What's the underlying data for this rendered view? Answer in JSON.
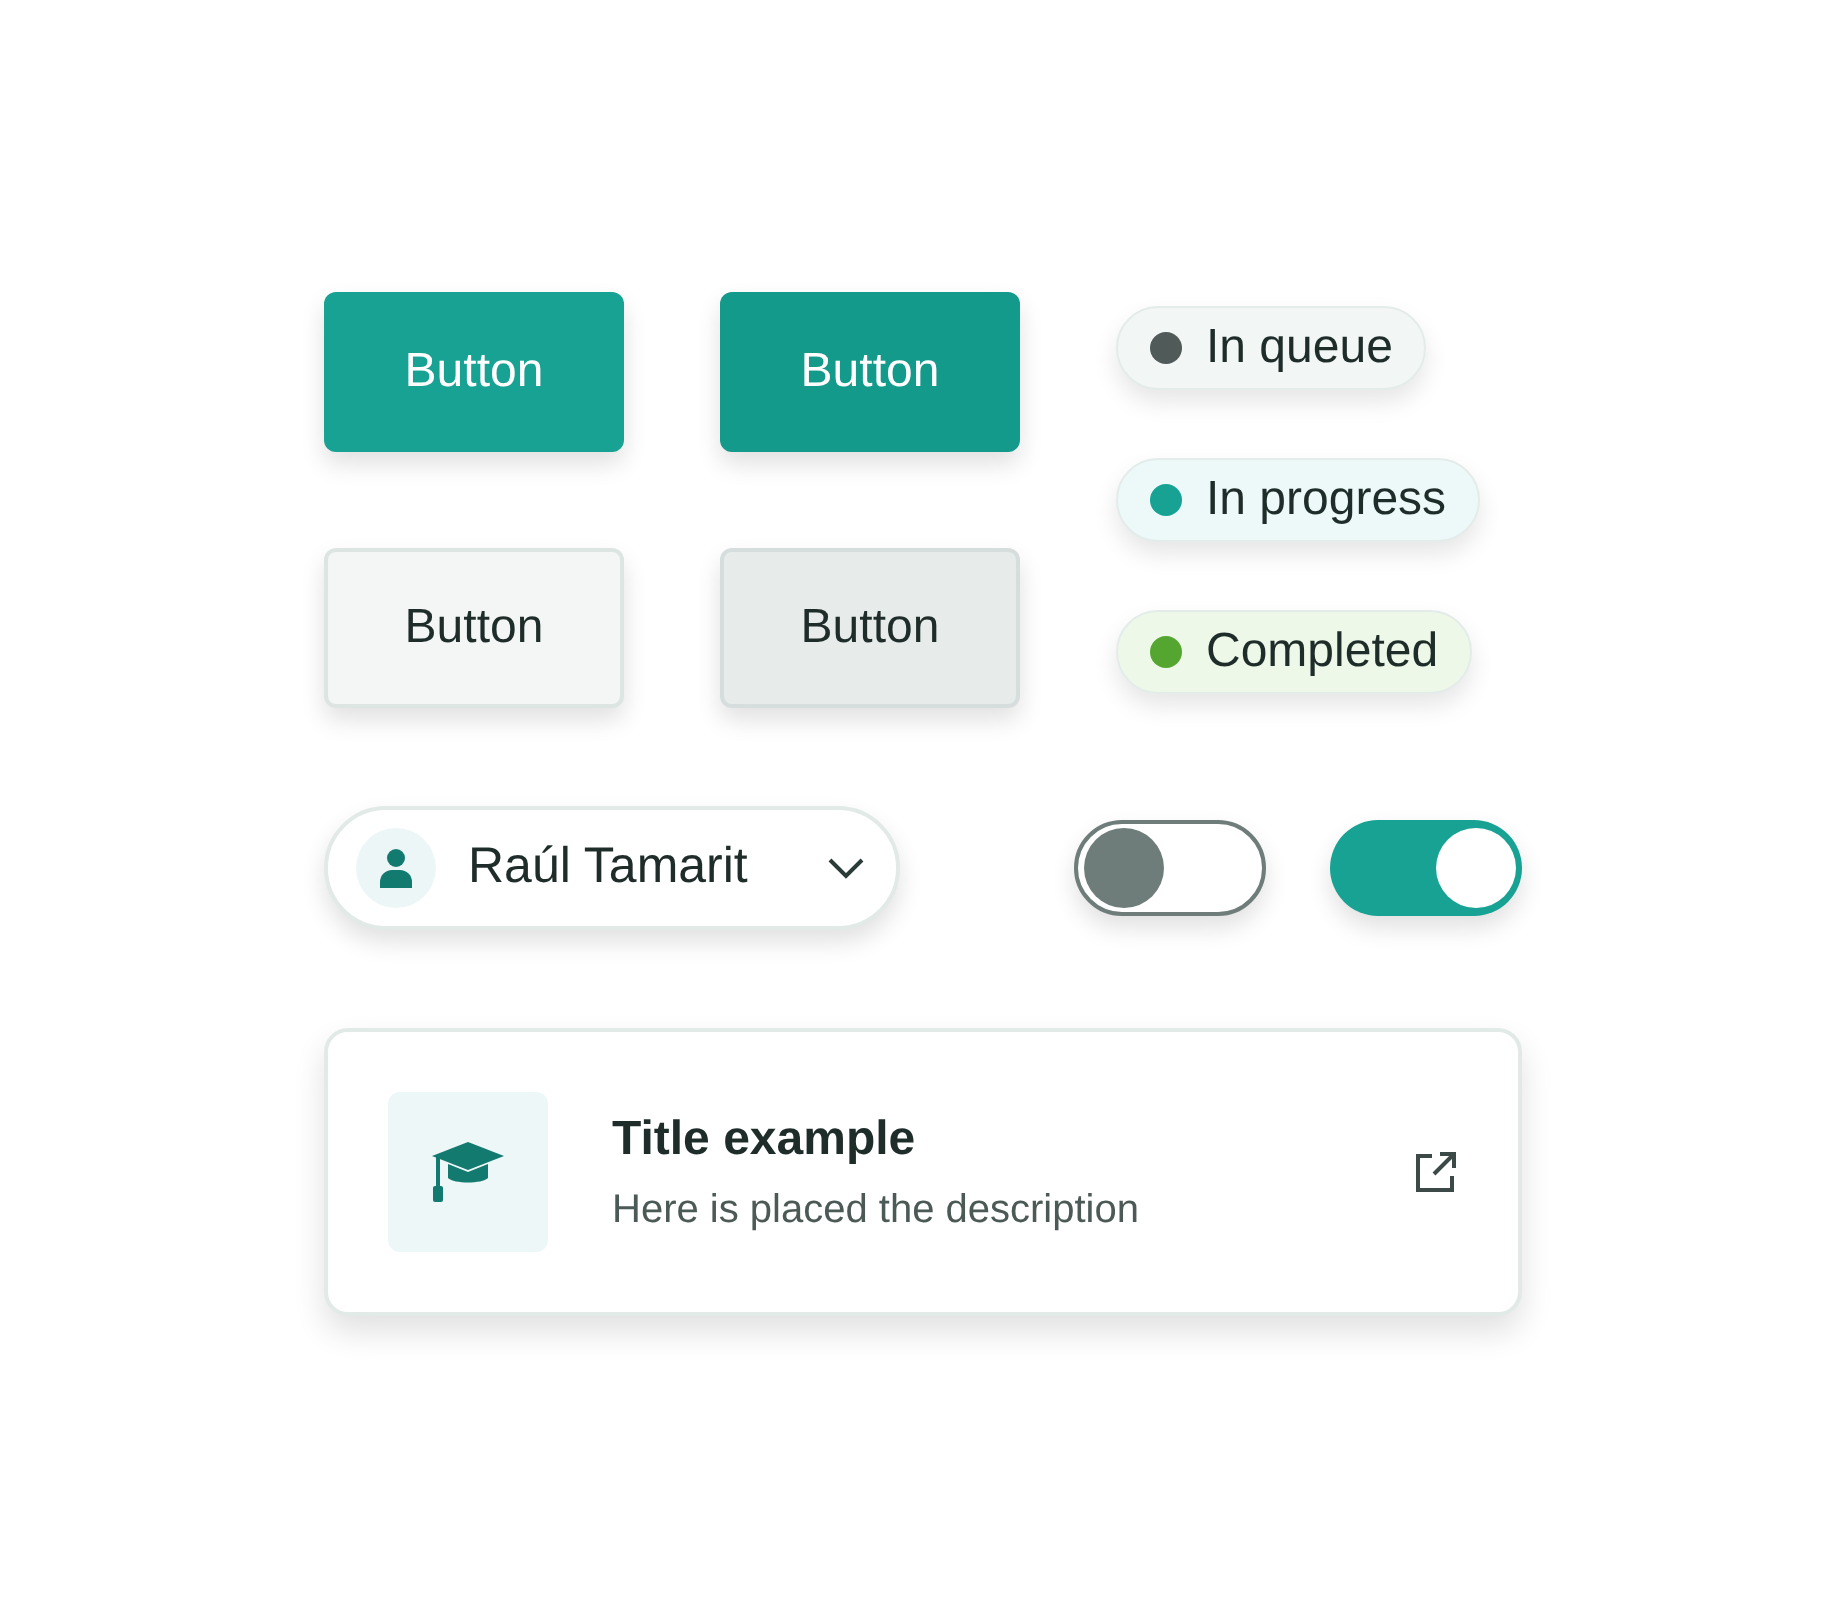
{
  "buttons": [
    {
      "label": "Button",
      "kind": "filled"
    },
    {
      "label": "Button",
      "kind": "filled_hover"
    },
    {
      "label": "Button",
      "kind": "light"
    },
    {
      "label": "Button",
      "kind": "light_hover"
    }
  ],
  "badges": [
    {
      "label": "In queue",
      "color": "#505a58"
    },
    {
      "label": "In progress",
      "color": "#17a294"
    },
    {
      "label": "Completed",
      "color": "#55a630"
    }
  ],
  "user_select": {
    "name": "Raúl Tamarit"
  },
  "toggles": [
    {
      "on": false
    },
    {
      "on": true
    }
  ],
  "card": {
    "title": "Title example",
    "description": "Here is placed the description"
  }
}
